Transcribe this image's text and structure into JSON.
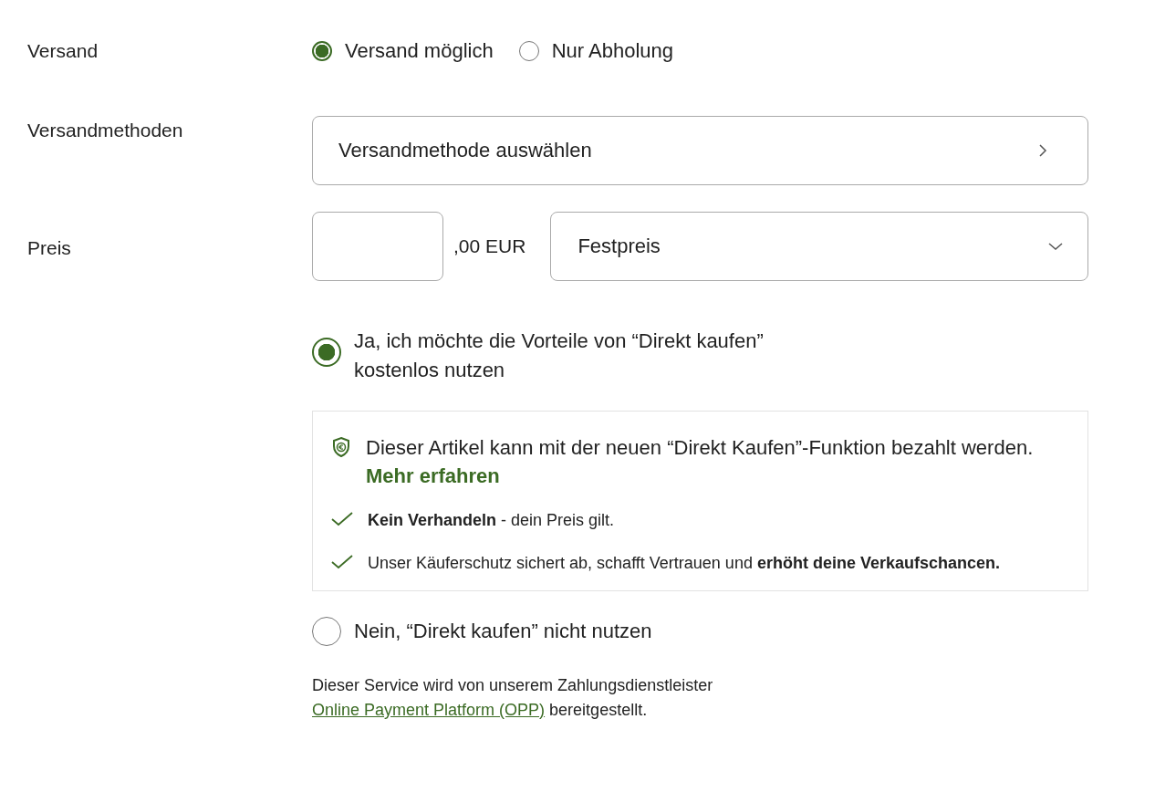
{
  "shipping": {
    "label": "Versand",
    "options": [
      {
        "label": "Versand möglich",
        "selected": true
      },
      {
        "label": "Nur Abholung",
        "selected": false
      }
    ]
  },
  "methods": {
    "label": "Versandmethoden",
    "button": "Versandmethode auswählen"
  },
  "price": {
    "label": "Preis",
    "suffix": ",00 EUR",
    "type": "Festpreis"
  },
  "direct_buy": {
    "yes": {
      "label": "Ja, ich möchte die Vorteile von “Direkt kaufen” kostenlos nutzen",
      "selected": true
    },
    "info": {
      "text": "Dieser Artikel kann mit der neuen “Direkt Kaufen”-Funktion bezahlt werden.",
      "link": "Mehr erfahren",
      "benefits": [
        "**Kein Verhandeln** - dein Preis gilt.",
        "Unser Käuferschutz sichert ab, schafft Vertrauen und **erhöht deine Verkaufschancen.**"
      ]
    },
    "no": {
      "label": "Nein, “Direkt kaufen” nicht nutzen",
      "selected": false
    }
  },
  "footnote": {
    "text": "Dieser Service wird von unserem Zahlungsdienstleister",
    "link": "Online Payment Platform (OPP)",
    "after": "bereitgestellt."
  }
}
